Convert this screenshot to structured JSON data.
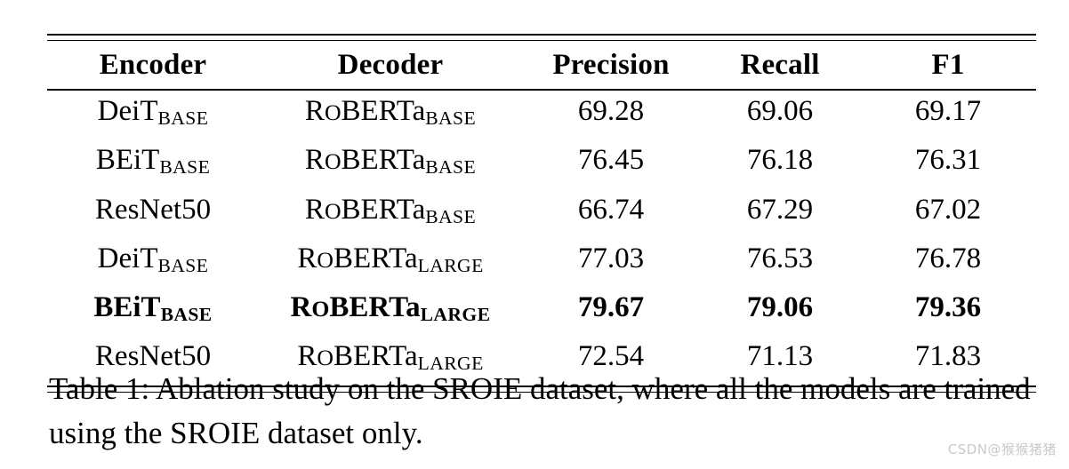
{
  "table": {
    "columns": [
      "Encoder",
      "Decoder",
      "Precision",
      "Recall",
      "F1"
    ],
    "rows": [
      {
        "encoder_base": "DeiT",
        "encoder_sub": "BASE",
        "decoder_head": "R",
        "decoder_sc": "o",
        "decoder_tail": "BERTa",
        "decoder_sub": "BASE",
        "precision": "69.28",
        "recall": "69.06",
        "f1": "69.17",
        "bold": false
      },
      {
        "encoder_base": "BEiT",
        "encoder_sub": "BASE",
        "decoder_head": "R",
        "decoder_sc": "o",
        "decoder_tail": "BERTa",
        "decoder_sub": "BASE",
        "precision": "76.45",
        "recall": "76.18",
        "f1": "76.31",
        "bold": false
      },
      {
        "encoder_base": "ResNet50",
        "encoder_sub": "",
        "decoder_head": "R",
        "decoder_sc": "o",
        "decoder_tail": "BERTa",
        "decoder_sub": "BASE",
        "precision": "66.74",
        "recall": "67.29",
        "f1": "67.02",
        "bold": false
      },
      {
        "encoder_base": "DeiT",
        "encoder_sub": "BASE",
        "decoder_head": "R",
        "decoder_sc": "o",
        "decoder_tail": "BERTa",
        "decoder_sub": "LARGE",
        "precision": "77.03",
        "recall": "76.53",
        "f1": "76.78",
        "bold": false
      },
      {
        "encoder_base": "BEiT",
        "encoder_sub": "BASE",
        "decoder_head": "R",
        "decoder_sc": "o",
        "decoder_tail": "BERTa",
        "decoder_sub": "LARGE",
        "precision": "79.67",
        "recall": "79.06",
        "f1": "79.36",
        "bold": true
      },
      {
        "encoder_base": "ResNet50",
        "encoder_sub": "",
        "decoder_head": "R",
        "decoder_sc": "o",
        "decoder_tail": "BERTa",
        "decoder_sub": "LARGE",
        "precision": "72.54",
        "recall": "71.13",
        "f1": "71.83",
        "bold": false
      }
    ]
  },
  "caption": {
    "text": "Table 1: Ablation study on the SROIE dataset, where all the models are trained using the SROIE dataset only."
  },
  "watermark": {
    "text": "CSDN@猴猴猪猪",
    "color": "#c9c9c9"
  },
  "chart_data": {
    "type": "table",
    "title": "Table 1: Ablation study on the SROIE dataset, where all the models are trained using the SROIE dataset only.",
    "columns": [
      "Encoder",
      "Decoder",
      "Precision",
      "Recall",
      "F1"
    ],
    "rows": [
      [
        "DeiT_BASE",
        "RoBERTa_BASE",
        69.28,
        69.06,
        69.17
      ],
      [
        "BEiT_BASE",
        "RoBERTa_BASE",
        76.45,
        76.18,
        76.31
      ],
      [
        "ResNet50",
        "RoBERTa_BASE",
        66.74,
        67.29,
        67.02
      ],
      [
        "DeiT_BASE",
        "RoBERTa_LARGE",
        77.03,
        76.53,
        76.78
      ],
      [
        "BEiT_BASE",
        "RoBERTa_LARGE",
        79.67,
        79.06,
        79.36
      ],
      [
        "ResNet50",
        "RoBERTa_LARGE",
        72.54,
        71.13,
        71.83
      ]
    ],
    "highlighted_row_index": 4,
    "highlight_reason": "best scores, shown in bold"
  }
}
